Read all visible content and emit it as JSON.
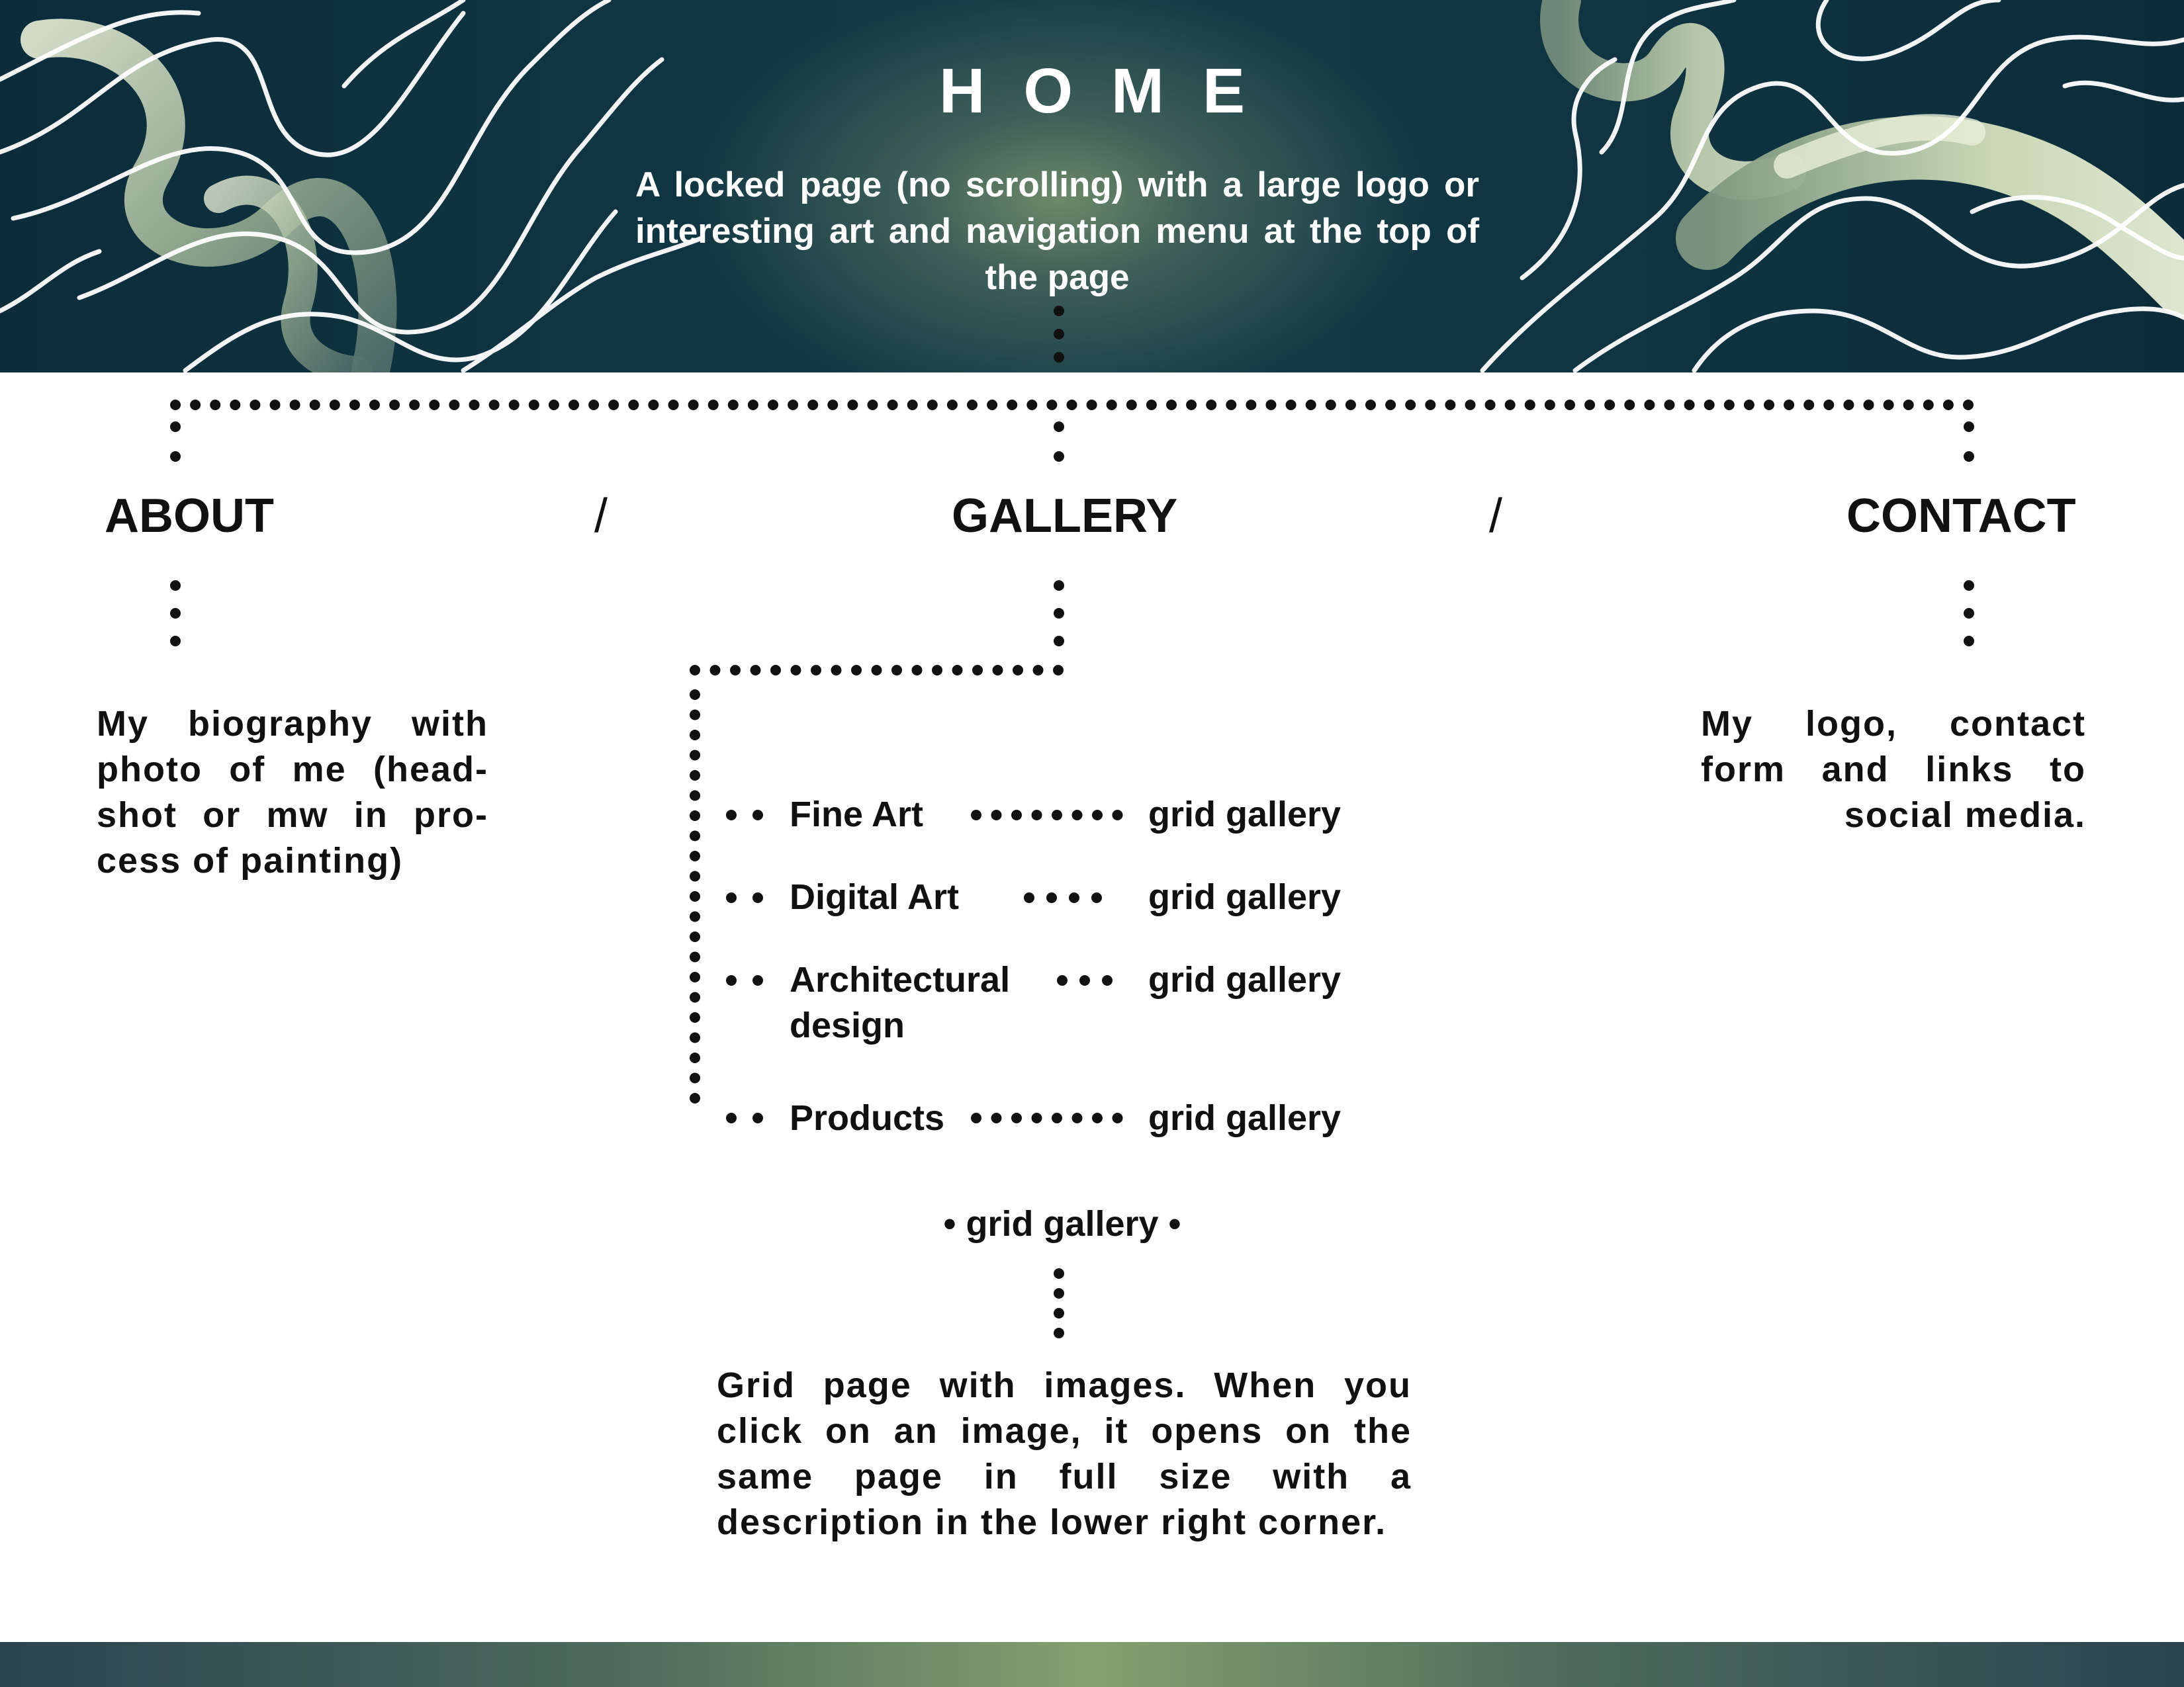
{
  "header": {
    "title": "HOME",
    "description": "A locked page (no scrolling) with a large logo or interesting art and navigation menu at the top of the page"
  },
  "nav": {
    "about": "ABOUT",
    "gallery": "GALLERY",
    "contact": "CONTACT",
    "separator": "/"
  },
  "about_desc": "My biography with photo of me (head-shot or mw in pro-cess of painting)",
  "contact_desc": "My logo, contact form and links to social media.",
  "gallery": {
    "categories": [
      {
        "label": "Fine Art",
        "target": "grid gallery"
      },
      {
        "label": "Digital Art",
        "target": "grid gallery"
      },
      {
        "label": "Architectural design",
        "target": "grid gallery"
      },
      {
        "label": "Products",
        "target": "grid gallery"
      }
    ],
    "grid_node": "• grid gallery •",
    "grid_desc": "Grid page with images. When you click on an image, it opens on the same page in full size with a description in the lower right corner."
  },
  "colors": {
    "header_dark": "#0c2c3a",
    "header_glow": "#6d8a6a",
    "swirl_light": "#ffffff",
    "ribbon": "#c9d8b0",
    "footer_glow": "#86a070",
    "text": "#111111"
  }
}
